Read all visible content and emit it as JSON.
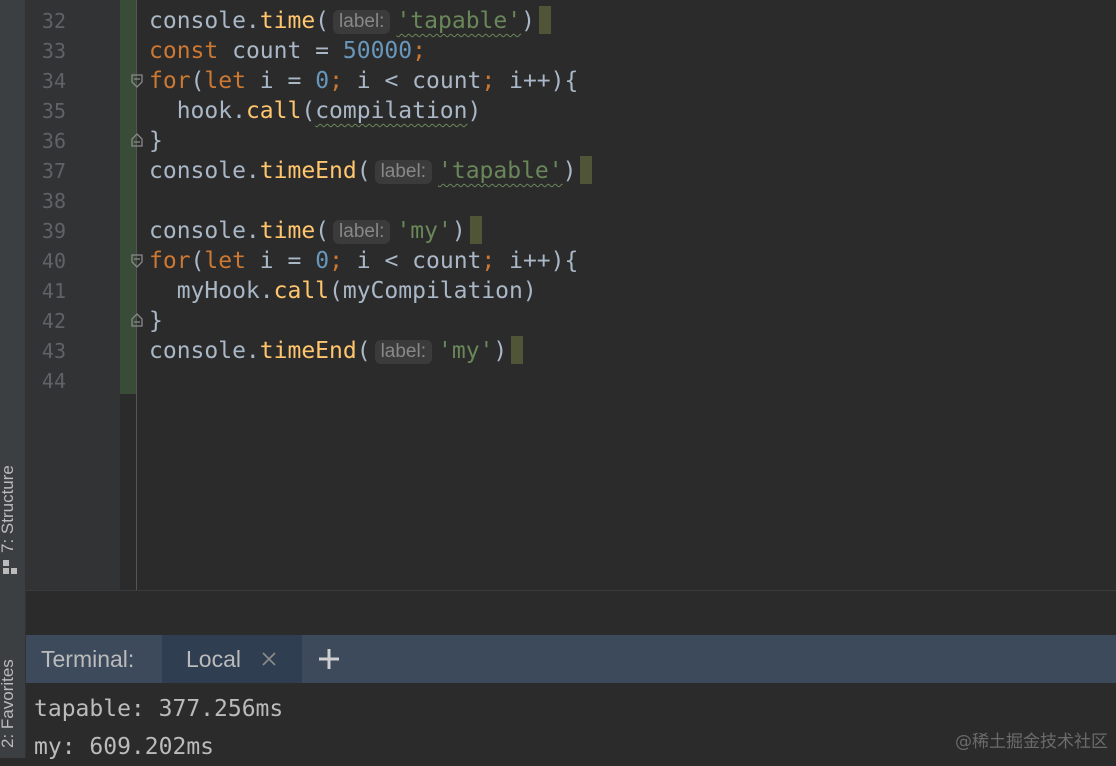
{
  "side_tabs": {
    "structure": "7: Structure",
    "favorites": "2: Favorites"
  },
  "gutter": {
    "line_numbers": [
      "32",
      "33",
      "34",
      "35",
      "36",
      "37",
      "38",
      "39",
      "40",
      "41",
      "42",
      "43",
      "44"
    ]
  },
  "code": {
    "l32": {
      "obj": "console.",
      "fn": "time",
      "open": "(",
      "hint": "label:",
      "str": "'tapable'",
      "close": ")"
    },
    "l33": {
      "kw": "const",
      "mid": " count = ",
      "num": "50000",
      "semi": ";"
    },
    "l34": {
      "kw_for": "for",
      "p1": "(",
      "kw_let": "let",
      "a": " i = ",
      "num": "0",
      "semi1": ";",
      "b": " i < count",
      "semi2": ";",
      "c": " i++){"
    },
    "l35": {
      "indent": "  hook.",
      "fn": "call",
      "open": "(",
      "arg": "compilation",
      "close": ")"
    },
    "l36": {
      "brace": "}"
    },
    "l37": {
      "obj": "console.",
      "fn": "timeEnd",
      "open": "(",
      "hint": "label:",
      "str": "'tapable'",
      "close": ")"
    },
    "l39": {
      "obj": "console.",
      "fn": "time",
      "open": "(",
      "hint": "label:",
      "str": "'my'",
      "close": ")"
    },
    "l40": {
      "kw_for": "for",
      "p1": "(",
      "kw_let": "let",
      "a": " i = ",
      "num": "0",
      "semi1": ";",
      "b": " i < count",
      "semi2": ";",
      "c": " i++){"
    },
    "l41": {
      "indent": "  myHook.",
      "fn": "call",
      "rest": "(myCompilation)"
    },
    "l42": {
      "brace": "}"
    },
    "l43": {
      "obj": "console.",
      "fn": "timeEnd",
      "open": "(",
      "hint": "label:",
      "str": "'my'",
      "close": ")"
    }
  },
  "terminal": {
    "title": "Terminal:",
    "tab_local": "Local",
    "output": [
      "tapable: 377.256ms",
      "my: 609.202ms"
    ]
  },
  "watermark": "@稀土掘金技术社区",
  "colors": {
    "background": "#2b2b2b",
    "keyword": "#cc7832",
    "function": "#ffc66d",
    "number": "#6897bb",
    "string": "#6a8759",
    "terminal_bar": "#3c4a5c"
  }
}
